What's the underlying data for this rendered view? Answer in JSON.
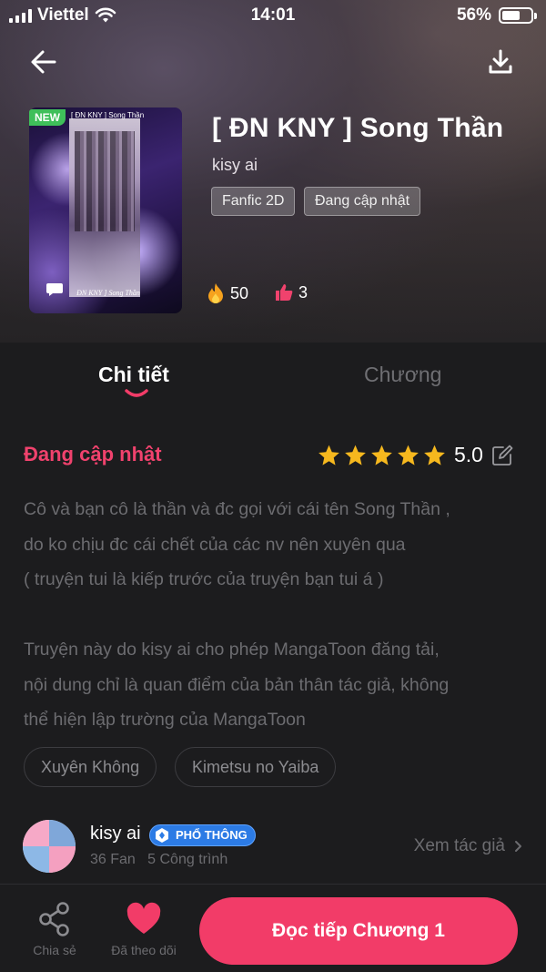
{
  "status_bar": {
    "carrier": "Viettel",
    "time": "14:01",
    "battery": "56%"
  },
  "book": {
    "title": "[ ĐN KNY ] Song Thần",
    "author": "kisy ai",
    "new_badge": "NEW",
    "cover_title": "[ ĐN KNY ] Song Thần",
    "cover_caption": "ĐN KNY ] Song Thần",
    "tags": [
      "Fanfic 2D",
      "Đang cập nhật"
    ],
    "stats": {
      "hot": "50",
      "likes": "3"
    }
  },
  "tabs": {
    "detail": "Chi tiết",
    "chapters": "Chương"
  },
  "detail": {
    "status": "Đang cập nhật",
    "rating": "5.0",
    "stars": 5,
    "description_lines": [
      "Cô và bạn cô là thần và đc gọi với cái tên Song Thần ,",
      "do ko chịu đc cái chết của các nv nên xuyên qua",
      "( truyện tui là kiếp trước của truyện bạn tui á )"
    ],
    "disclaimer_lines": [
      "Truyện này do kisy ai cho phép MangaToon đăng tải,",
      "nội dung chỉ là quan điểm của bản thân tác giả, không",
      "thể hiện lập trường của MangaToon"
    ],
    "genres": [
      "Xuyên Không",
      "Kimetsu no Yaiba"
    ]
  },
  "author": {
    "name": "kisy ai",
    "level": "PHỔ THÔNG",
    "fans": "36 Fan",
    "works": "5 Công trình",
    "view_label": "Xem tác giả"
  },
  "bottom_bar": {
    "share_label": "Chia sẻ",
    "follow_label": "Đã theo dõi",
    "read_label": "Đọc tiếp Chương 1"
  },
  "colors": {
    "accent": "#f23c68",
    "status_pink": "#f0426d",
    "star": "#f6b81e",
    "badge_blue": "#2c7be5",
    "new_green": "#3fbf5a"
  }
}
